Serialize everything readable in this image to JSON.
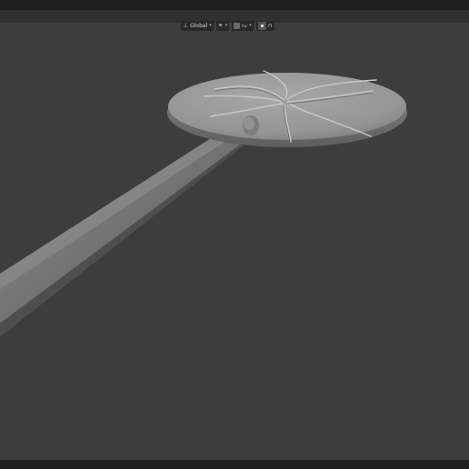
{
  "header": {
    "orientation_icon": "transform-orientation-icon",
    "orientation_label": "Global",
    "pivot_icon": "link-icon",
    "snap_icon": "snap-icon",
    "snap_label": "Inc",
    "proportional_icon": "proportional-edit-icon",
    "falloff_icon": "falloff-curve-icon"
  },
  "viewport": {
    "object": "lollipop-mesh"
  },
  "colors": {
    "background": "#3d3d3d",
    "header": "#303030",
    "topbar": "#1f1f1f"
  }
}
